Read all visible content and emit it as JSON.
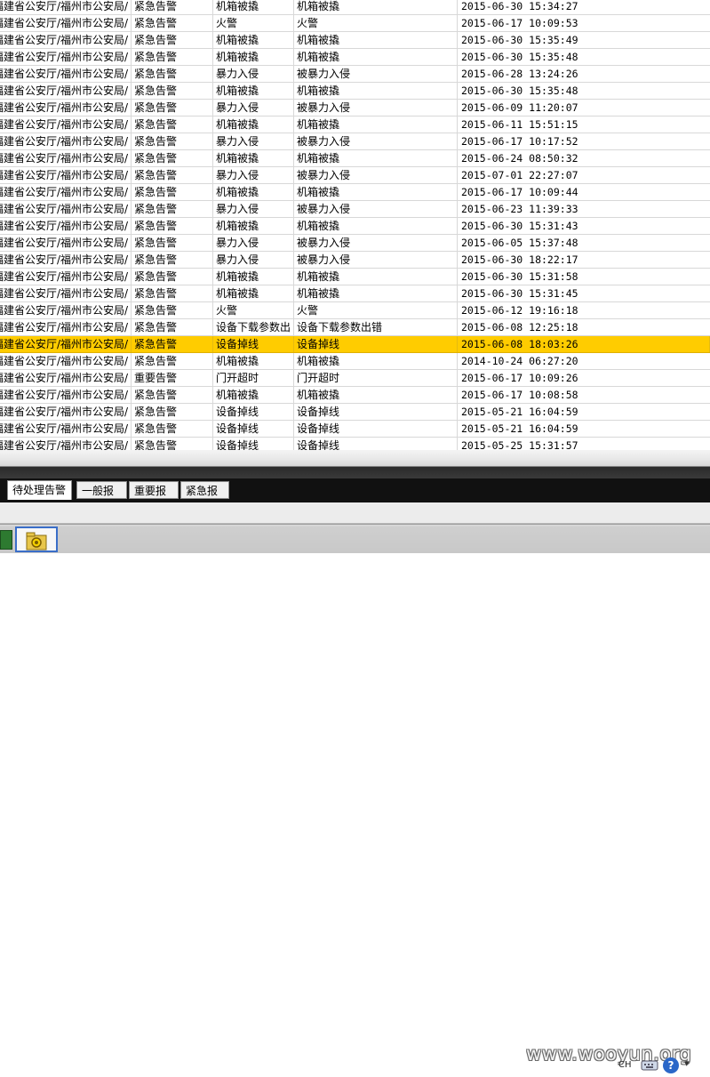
{
  "table": {
    "rows": [
      {
        "org": "福建省公安厅/福州市公安局/",
        "level": "紧急告警",
        "type": "机箱被撬",
        "desc": "机箱被撬",
        "time": "2015-06-30 15:34:27"
      },
      {
        "org": "福建省公安厅/福州市公安局/",
        "level": "紧急告警",
        "type": "火警",
        "desc": "火警",
        "time": "2015-06-17 10:09:53"
      },
      {
        "org": "福建省公安厅/福州市公安局/",
        "level": "紧急告警",
        "type": "机箱被撬",
        "desc": "机箱被撬",
        "time": "2015-06-30 15:35:49"
      },
      {
        "org": "福建省公安厅/福州市公安局/",
        "level": "紧急告警",
        "type": "机箱被撬",
        "desc": "机箱被撬",
        "time": "2015-06-30 15:35:48"
      },
      {
        "org": "福建省公安厅/福州市公安局/",
        "level": "紧急告警",
        "type": "暴力入侵",
        "desc": "被暴力入侵",
        "time": "2015-06-28 13:24:26"
      },
      {
        "org": "福建省公安厅/福州市公安局/",
        "level": "紧急告警",
        "type": "机箱被撬",
        "desc": "机箱被撬",
        "time": "2015-06-30 15:35:48"
      },
      {
        "org": "福建省公安厅/福州市公安局/",
        "level": "紧急告警",
        "type": "暴力入侵",
        "desc": "被暴力入侵",
        "time": "2015-06-09 11:20:07"
      },
      {
        "org": "福建省公安厅/福州市公安局/",
        "level": "紧急告警",
        "type": "机箱被撬",
        "desc": "机箱被撬",
        "time": "2015-06-11 15:51:15"
      },
      {
        "org": "福建省公安厅/福州市公安局/",
        "level": "紧急告警",
        "type": "暴力入侵",
        "desc": "被暴力入侵",
        "time": "2015-06-17 10:17:52"
      },
      {
        "org": "福建省公安厅/福州市公安局/",
        "level": "紧急告警",
        "type": "机箱被撬",
        "desc": "机箱被撬",
        "time": "2015-06-24 08:50:32"
      },
      {
        "org": "福建省公安厅/福州市公安局/",
        "level": "紧急告警",
        "type": "暴力入侵",
        "desc": "被暴力入侵",
        "time": "2015-07-01 22:27:07"
      },
      {
        "org": "福建省公安厅/福州市公安局/",
        "level": "紧急告警",
        "type": "机箱被撬",
        "desc": "机箱被撬",
        "time": "2015-06-17 10:09:44"
      },
      {
        "org": "福建省公安厅/福州市公安局/",
        "level": "紧急告警",
        "type": "暴力入侵",
        "desc": "被暴力入侵",
        "time": "2015-06-23 11:39:33"
      },
      {
        "org": "福建省公安厅/福州市公安局/",
        "level": "紧急告警",
        "type": "机箱被撬",
        "desc": "机箱被撬",
        "time": "2015-06-30 15:31:43"
      },
      {
        "org": "福建省公安厅/福州市公安局/",
        "level": "紧急告警",
        "type": "暴力入侵",
        "desc": "被暴力入侵",
        "time": "2015-06-05 15:37:48"
      },
      {
        "org": "福建省公安厅/福州市公安局/",
        "level": "紧急告警",
        "type": "暴力入侵",
        "desc": "被暴力入侵",
        "time": "2015-06-30 18:22:17"
      },
      {
        "org": "福建省公安厅/福州市公安局/",
        "level": "紧急告警",
        "type": "机箱被撬",
        "desc": "机箱被撬",
        "time": "2015-06-30 15:31:58"
      },
      {
        "org": "福建省公安厅/福州市公安局/",
        "level": "紧急告警",
        "type": "机箱被撬",
        "desc": "机箱被撬",
        "time": "2015-06-30 15:31:45"
      },
      {
        "org": "福建省公安厅/福州市公安局/",
        "level": "紧急告警",
        "type": "火警",
        "desc": "火警",
        "time": "2015-06-12 19:16:18"
      },
      {
        "org": "福建省公安厅/福州市公安局/",
        "level": "紧急告警",
        "type": "设备下载参数出",
        "desc": "设备下载参数出错",
        "time": "2015-06-08 12:25:18"
      },
      {
        "org": "福建省公安厅/福州市公安局/",
        "level": "紧急告警",
        "type": "设备掉线",
        "desc": "设备掉线",
        "time": "2015-06-08 18:03:26",
        "selected": true
      },
      {
        "org": "福建省公安厅/福州市公安局/",
        "level": "紧急告警",
        "type": "机箱被撬",
        "desc": "机箱被撬",
        "time": "2014-10-24 06:27:20"
      },
      {
        "org": "福建省公安厅/福州市公安局/",
        "level": "重要告警",
        "type": "门开超时",
        "desc": "门开超时",
        "time": "2015-06-17 10:09:26"
      },
      {
        "org": "福建省公安厅/福州市公安局/",
        "level": "紧急告警",
        "type": "机箱被撬",
        "desc": "机箱被撬",
        "time": "2015-06-17 10:08:58"
      },
      {
        "org": "福建省公安厅/福州市公安局/",
        "level": "紧急告警",
        "type": "设备掉线",
        "desc": "设备掉线",
        "time": "2015-05-21 16:04:59"
      },
      {
        "org": "福建省公安厅/福州市公安局/",
        "level": "紧急告警",
        "type": "设备掉线",
        "desc": "设备掉线",
        "time": "2015-05-21 16:04:59"
      },
      {
        "org": "福建省公安厅/福州市公安局/",
        "level": "紧急告警",
        "type": "设备掉线",
        "desc": "设备掉线",
        "time": "2015-05-25 15:31:57"
      }
    ]
  },
  "tabs": [
    {
      "label": "待处理告警",
      "active": true
    },
    {
      "label": "一般报警",
      "active": false
    },
    {
      "label": "重要报警",
      "active": false
    },
    {
      "label": "紧急报警",
      "active": false
    }
  ],
  "taskbar": {
    "watermark": "www.wooyun.org",
    "lang": "CH",
    "help": "?",
    "arrow": "▾"
  },
  "colors": {
    "selected_row": "#ffcc00",
    "tabbar_bg": "#111111"
  },
  "icons": [
    "app-window-icon",
    "gear-folder-icon",
    "keyboard-icon",
    "help-icon",
    "tray-arrow-icon"
  ]
}
